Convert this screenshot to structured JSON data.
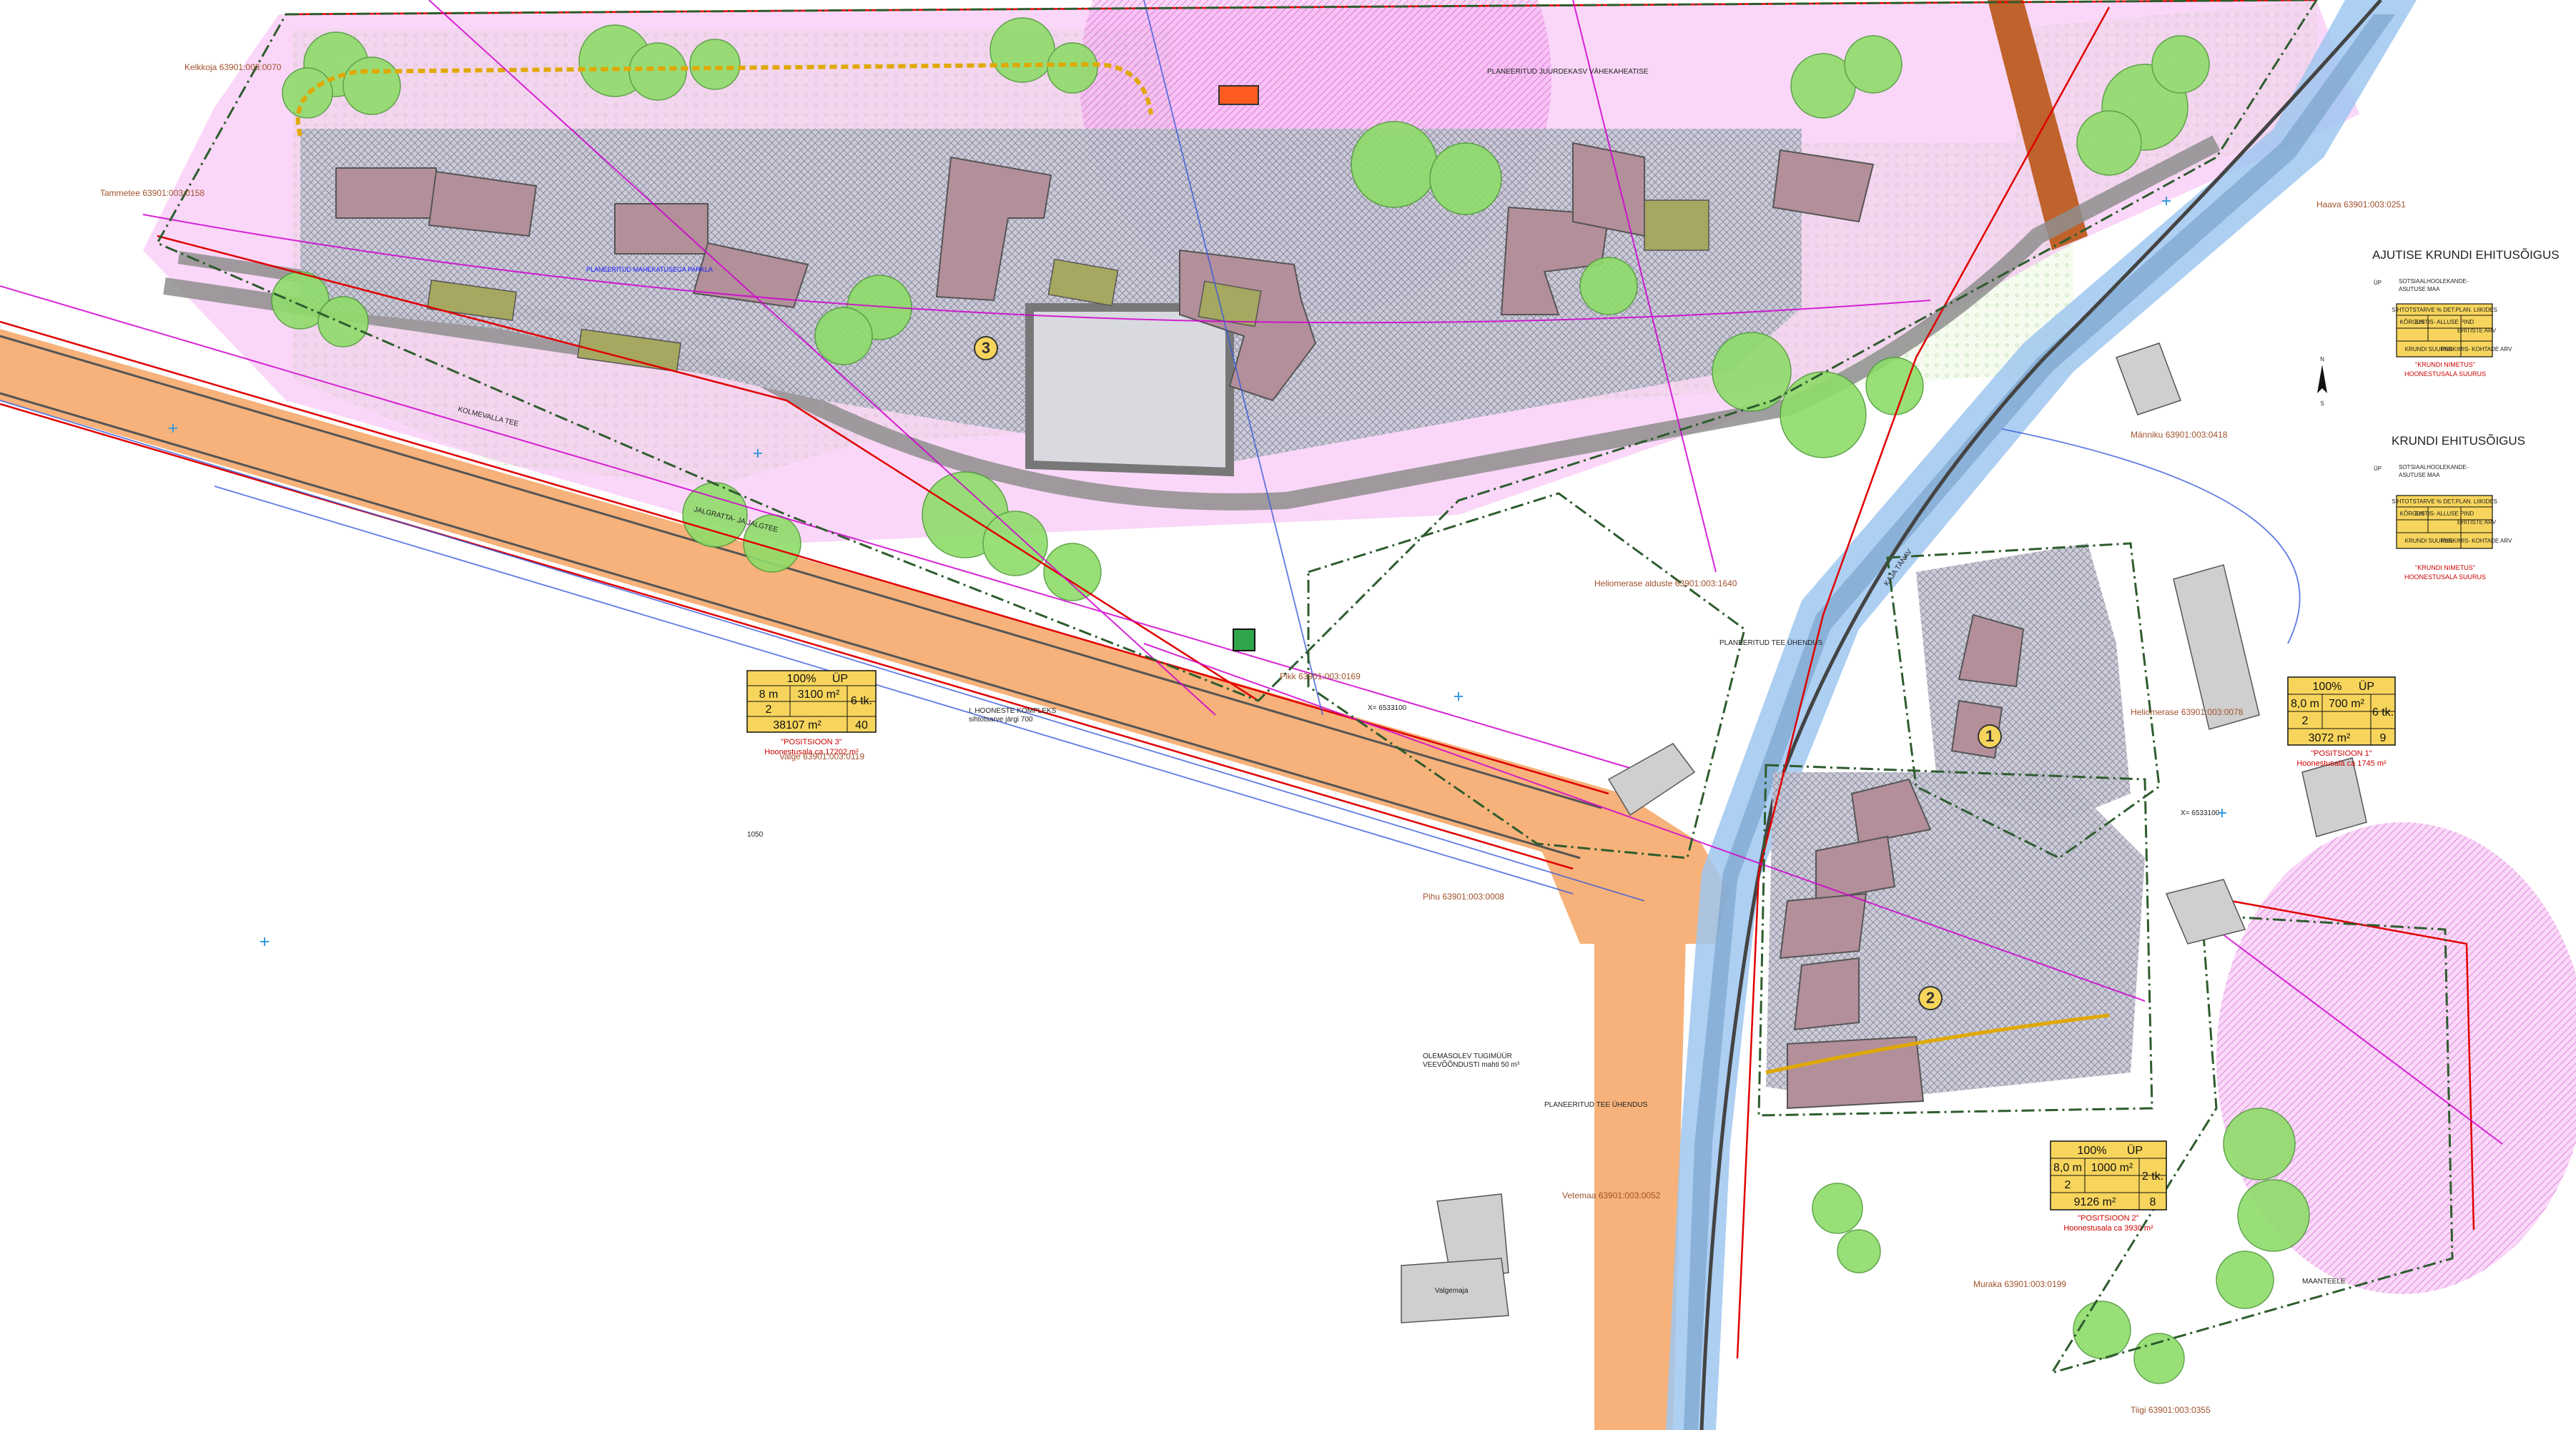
{
  "colors": {
    "road": "#f6b27a",
    "street_blue": "#9fc7f0",
    "zone_pink": "#f3a6ef",
    "built_area": "#c9c9d6",
    "building": "#b38f9a",
    "green": "#8fdc6a",
    "table_fill": "#f7d55c",
    "red_line": "#e00000",
    "boundary": "#2e5c2e"
  },
  "lots": [
    {
      "id": "3",
      "icon": "circle-marker"
    },
    {
      "id": "1",
      "icon": "circle-marker"
    },
    {
      "id": "2",
      "icon": "circle-marker"
    }
  ],
  "tables": [
    {
      "key": "lot3",
      "pct": "100%",
      "up": "ÜP",
      "height": "8 m",
      "floors": "2",
      "area": "3100 m²",
      "units": "6 tk.",
      "lot_area": "38107 m²",
      "parking": "40",
      "caption": "\"POSITSIOON 3\"",
      "caption2": "Hoonestusala ca 17202 m²"
    },
    {
      "key": "lot1",
      "pct": "100%",
      "up": "ÜP",
      "height": "8,0 m",
      "floors": "2",
      "area": "700 m²",
      "units": "6 tk.",
      "lot_area": "3072 m²",
      "parking": "9",
      "caption": "\"POSITSIOON 1\"",
      "caption2": "Hoonestusala ca 1745 m²"
    },
    {
      "key": "lot2",
      "pct": "100%",
      "up": "ÜP",
      "height": "8,0 m",
      "floors": "2",
      "area": "1000 m²",
      "units": "2 tk.",
      "lot_area": "9126 m²",
      "parking": "8",
      "caption": "\"POSITSIOON 2\"",
      "caption2": "Hoonestusala ca 3930 m²"
    }
  ],
  "legend": {
    "temp_title": "AJUTISE KRUNDI EHITUSÕIGUS",
    "temp_code": "ÜP",
    "temp_desc1": "SOTSIAALHOOLEKANDE-",
    "temp_desc2": "ASUTUSE MAA",
    "temp_red1": "\"KRUNDI NIMETUS\"",
    "temp_red2": "HOONESTUSALA SUURUS",
    "main_title": "KRUNDI EHITUSÕIGUS",
    "main_code": "ÜP",
    "main_desc1": "SOTSIAALHOOLEKANDE-",
    "main_desc2": "ASUTUSE MAA",
    "cell_header": "SIHTOTSTARVE % DET.PLAN. LIIKIDES",
    "cell_a": "KÕRGUS",
    "cell_b": "EHITIS- ALLUSE PIND",
    "cell_c": "EHITISTE ARV",
    "cell_d": "KRUNDI SUURUS",
    "cell_e": "PARKIMIS- KOHTADE ARV",
    "main_red1": "\"KRUNDI NIMETUS\"",
    "main_red2": "HOONESTUSALA SUURUS",
    "north": "N",
    "south": "S"
  },
  "labels": {
    "planned_apartment": "PLANEERITUD JUURDEKASV VÄHEKAHEATISE",
    "planned_parking_1": "PLANEERITUD MAHEKATUSEGA PARKLA",
    "planned_road_junction": "PLANEERITUD TEE ÜHENDUS",
    "planned_road_junction2": "PLANEERITUD TEE ÜHENDUS",
    "existing_culvert": "OLEMASOLEV TUGIMÜÜR",
    "culvert_sub": "VEEVÕÕNDUSTI mahti 50 m³",
    "building_complex": "I. HOONESTE KOMPLEKS",
    "building_complex_sub": "sihtotsarve järgi 700",
    "tee_label": "KAJA TÄNAV",
    "maanteelt": "MAANTEELE",
    "building_valge": "Valgemaja",
    "road_label_1": "KOLMEVALLA TEE",
    "road_label_2": "JALGRATTA- JA JALGTEE",
    "coord_1": "X= 6533100",
    "coord_2": "X= 6533100",
    "tee_nr": "1050"
  },
  "addresses": [
    "Valge 63901:003:0119",
    "Pikk 63901:003:0169",
    "Heliomerase alduste 63901:003:1640",
    "Pihu 63901:003:0008",
    "Vetemaa 63901:003:0052",
    "Muraka 63901:003:0199",
    "Heliomerase 63901:003:0078",
    "Haava 63901:003:0251",
    "Männiku 63901:003:0418",
    "Tiigi 63901:003:0355",
    "Kelkkoja 63901:003:0070",
    "Tammetee 63901:003:0158"
  ]
}
